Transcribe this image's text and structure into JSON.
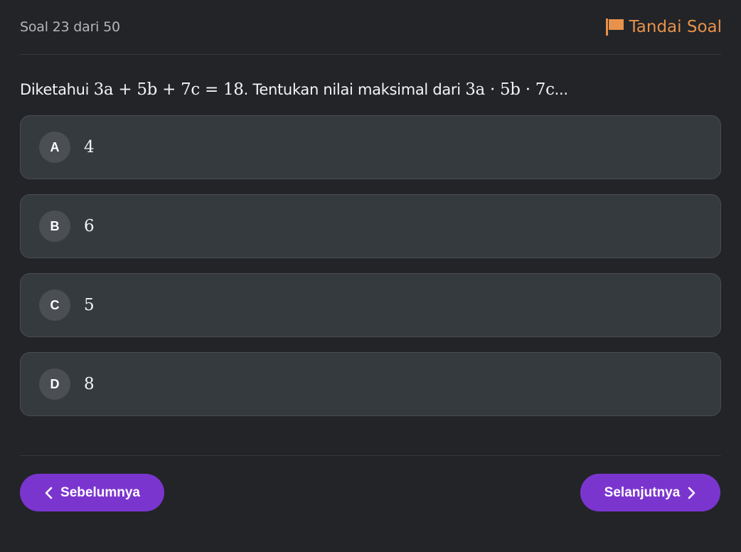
{
  "header": {
    "counter": "Soal 23 dari 50",
    "flag_label": "Tandai Soal",
    "flag_icon": "flag-icon",
    "accent_color": "#e8914a"
  },
  "question": {
    "prefix": "Diketahui ",
    "condition": "3a + 5b + 7c = 18",
    "middle": ". Tentukan nilai maksimal dari ",
    "expression": "3a · 5b · 7c",
    "suffix": "..."
  },
  "options": [
    {
      "letter": "A",
      "value": "4"
    },
    {
      "letter": "B",
      "value": "6"
    },
    {
      "letter": "C",
      "value": "5"
    },
    {
      "letter": "D",
      "value": "8"
    }
  ],
  "navigation": {
    "prev_label": "Sebelumnya",
    "next_label": "Selanjutnya",
    "prev_icon": "chevron-left-icon",
    "next_icon": "chevron-right-icon",
    "button_color": "#7b35cf"
  }
}
